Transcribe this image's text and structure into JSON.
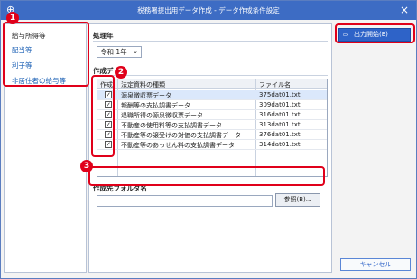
{
  "window": {
    "title": "税務署提出用データ作成 - データ作成条件設定",
    "app_icon": "⊕",
    "close_icon": "×"
  },
  "sidebar": {
    "items": [
      {
        "label": "給与所得等",
        "active": true
      },
      {
        "label": "配当等",
        "active": false
      },
      {
        "label": "利子等",
        "active": false
      },
      {
        "label": "非居住者の給与等",
        "active": false
      }
    ]
  },
  "main": {
    "year_section": {
      "label": "処理年",
      "combo_value": "令和 1年",
      "combo_icon": "chevron-down-icon"
    },
    "data_section": {
      "label": "作成デ",
      "headers": {
        "check": "作成",
        "type": "法定資料の種類",
        "file": "ファイル名"
      },
      "rows": [
        {
          "checked": true,
          "name": "源泉徴収票データ",
          "file": "375dat01.txt",
          "selected": true
        },
        {
          "checked": true,
          "name": "報酬等の支払調書データ",
          "file": "309dat01.txt",
          "selected": false
        },
        {
          "checked": true,
          "name": "退職所得の源泉徴収票データ",
          "file": "316dat01.txt",
          "selected": false
        },
        {
          "checked": true,
          "name": "不動産の使用料等の支払調書データ",
          "file": "313dat01.txt",
          "selected": false
        },
        {
          "checked": true,
          "name": "不動産等の譲受けの対価の支払調書データ",
          "file": "376dat01.txt",
          "selected": false
        },
        {
          "checked": true,
          "name": "不動産等のあっせん料の支払調書データ",
          "file": "314dat01.txt",
          "selected": false
        }
      ]
    },
    "folder_section": {
      "label": "作成先フォルダ名",
      "path_value": "",
      "browse_label": "参照(B)..."
    }
  },
  "actions": {
    "start_label": "出力開始(E)",
    "cancel_label": "キャンセル"
  },
  "callouts": {
    "badge1": "1",
    "badge2": "2",
    "badge3": "3"
  },
  "colors": {
    "accent": "#2e63c8",
    "titlebar": "#3d6cc4",
    "callout": "#e0001a",
    "selected_row": "#dbe8fb"
  }
}
